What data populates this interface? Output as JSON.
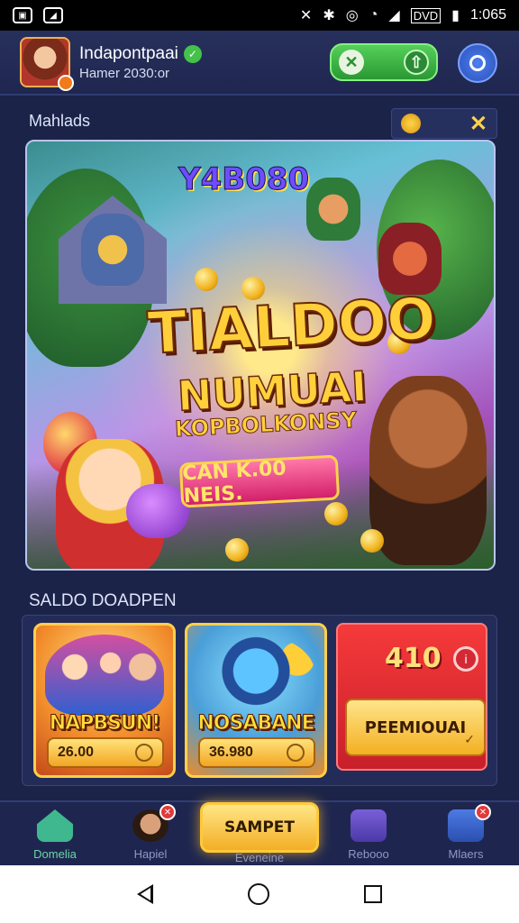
{
  "status_bar": {
    "time": "1:065",
    "carrier_badge": "DVD",
    "icons": [
      "photo-icon",
      "image-icon",
      "mute-icon",
      "bluetooth-icon",
      "nfc-icon",
      "wifi-icon",
      "signal-icon",
      "battery-icon"
    ]
  },
  "header": {
    "username": "Indapontpaai",
    "subtitle": "Hamer 2030:or",
    "search_icon": "search-icon"
  },
  "featured": {
    "section_label": "Mahlads",
    "banner": {
      "top_text": "Y4B080",
      "title_line1": "TIALDOO",
      "title_line2": "NUMUAI",
      "title_line3": "KOPBOLKONSY",
      "cta_label": "CAN K.00 NEIS."
    }
  },
  "cards": {
    "section_label": "SALDO DOADPEN",
    "items": [
      {
        "title": "NAPBSUN!",
        "price": "26.00"
      },
      {
        "title": "NOSABANE",
        "price": "36.980"
      }
    ],
    "promo": {
      "value": "410",
      "button_label": "PEEMIOUAI"
    }
  },
  "tab_bar": {
    "tabs": [
      {
        "label": "Domelia"
      },
      {
        "label": "Hapiel"
      },
      {
        "label": "Rebooo"
      },
      {
        "label": "Mlaers"
      }
    ],
    "center_button": "SAMPET",
    "center_label": "Eveneine"
  }
}
